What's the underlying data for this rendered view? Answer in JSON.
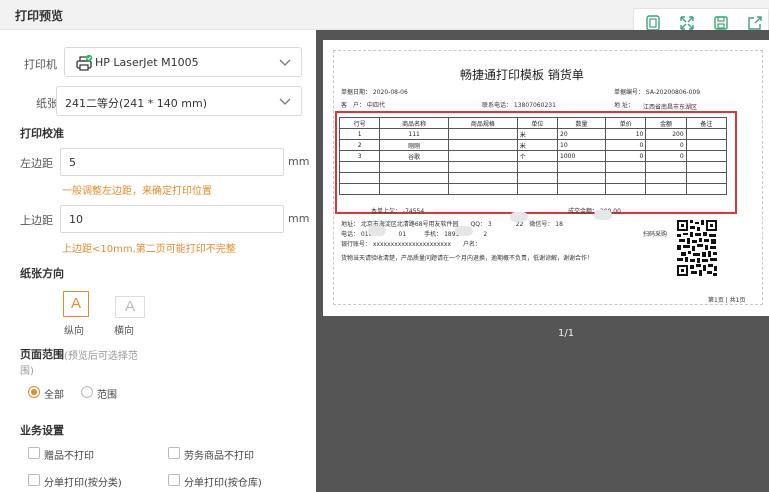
{
  "title": "打印预览",
  "printer": {
    "label": "打印机",
    "value": "HP LaserJet M1005"
  },
  "paper": {
    "label": "纸张",
    "value": "241二等分(241 * 140 mm)"
  },
  "calibration": {
    "heading": "打印校准",
    "left_margin_label": "左边距",
    "left_margin_value": "5",
    "left_unit": "mm",
    "left_hint": "一般调整左边距，来确定打印位置",
    "top_margin_label": "上边距",
    "top_margin_value": "10",
    "top_unit": "mm",
    "top_hint": "上边距<10mm,第二页可能打印不完整"
  },
  "orientation": {
    "heading": "纸张方向",
    "portrait": "纵向",
    "landscape": "横向",
    "glyph": "A"
  },
  "range": {
    "heading": "页面范围",
    "note": "(预览后可选择范",
    "note2": "围)",
    "all": "全部",
    "custom": "范围"
  },
  "business": {
    "heading": "业务设置",
    "opt1": "赠品不打印",
    "opt2": "劳务商品不打印",
    "opt3": "分单打印(按分类)",
    "opt4": "分单打印(按仓库)"
  },
  "toolbar": {
    "icons": [
      "page-icon",
      "fullscreen-icon",
      "save-icon",
      "export-icon"
    ]
  },
  "preview": {
    "doc_title": "畅捷通打印模板 销货单",
    "date": "单据日期： 2020-08-06",
    "customer": "客　户： 中四代",
    "phone": "联系电话： 13807060231",
    "doc_no": "单据编号： SA-20200806-009",
    "address": "地 址：",
    "address_val": "江西省南昌市东湖区",
    "headers": [
      "行号",
      "商品名称",
      "商品规格",
      "单位",
      "数量",
      "单价",
      "金额",
      "备注"
    ],
    "rows": [
      [
        "1",
        "111",
        "",
        "米",
        "20",
        "10",
        "200",
        ""
      ],
      [
        "2",
        "刚刚",
        "",
        "米",
        "10",
        "0",
        "0",
        ""
      ],
      [
        "3",
        "谷歌",
        "",
        "个",
        "1000",
        "0",
        "0",
        ""
      ]
    ],
    "total_label": "本单上欠： -74554",
    "deal_label": "成交金额： 200.00",
    "company_line": "地址： 北京市海淀区北清路68号用友软件园　　QQ： 3　　　　22　微信号： 18",
    "tel_line": "电话： 010-　　　　01　　　手机： 1891　　　　2",
    "bank_line": "银行账号： xxxxxxxxxxxxxxxxxxxxxx　　户名：",
    "notice": "货物当天请验收清楚，产品质量问题请在一个月内退换，逾期概不负责，低谢谅解，谢谢合作！",
    "scan": "扫码采购",
    "page_footer": "第1页 | 共1页",
    "pager": "1/1"
  }
}
